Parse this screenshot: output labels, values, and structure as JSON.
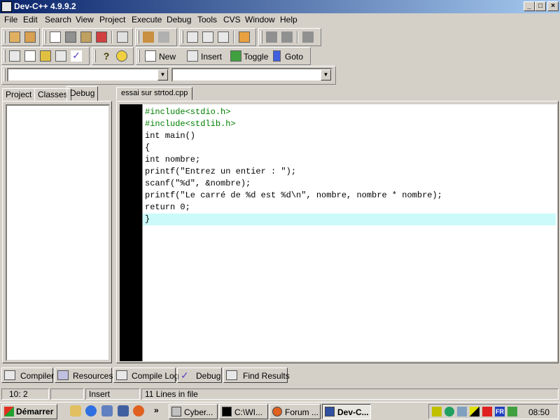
{
  "window": {
    "title": "Dev-C++ 4.9.9.2",
    "controls": [
      "_",
      "□",
      "×"
    ]
  },
  "menu": [
    "File",
    "Edit",
    "Search",
    "View",
    "Project",
    "Execute",
    "Debug",
    "Tools",
    "CVS",
    "Window",
    "Help"
  ],
  "toolbar2": {
    "new_label": "New",
    "insert_label": "Insert",
    "toggle_label": "Toggle",
    "goto_label": "Goto"
  },
  "combos": {
    "left_value": "",
    "right_value": ""
  },
  "left_tabs": [
    "Project",
    "Classes",
    "Debug"
  ],
  "editor": {
    "tab": "essai sur strtod.cpp",
    "lines": [
      "#include<stdio.h>",
      "#include<stdlib.h>",
      "int main()",
      "{",
      "int nombre;",
      "printf(\"Entrez un entier : \");",
      "scanf(\"%d\", &nombre);",
      "printf(\"Le carré de %d est %d\\n\", nombre, nombre * nombre);",
      "return 0;",
      "}"
    ]
  },
  "bottom_tabs": [
    "Compiler",
    "Resources",
    "Compile Log",
    "Debug",
    "Find Results"
  ],
  "status": {
    "position": "10: 2",
    "mode": "Insert",
    "lines": "11 Lines in file"
  },
  "taskbar": {
    "start": "Démarrer",
    "tasks": [
      "Cyber...",
      "C:\\WI...",
      "Forum ...",
      "Dev-C..."
    ],
    "time": "08:50",
    "lang": "FR"
  }
}
